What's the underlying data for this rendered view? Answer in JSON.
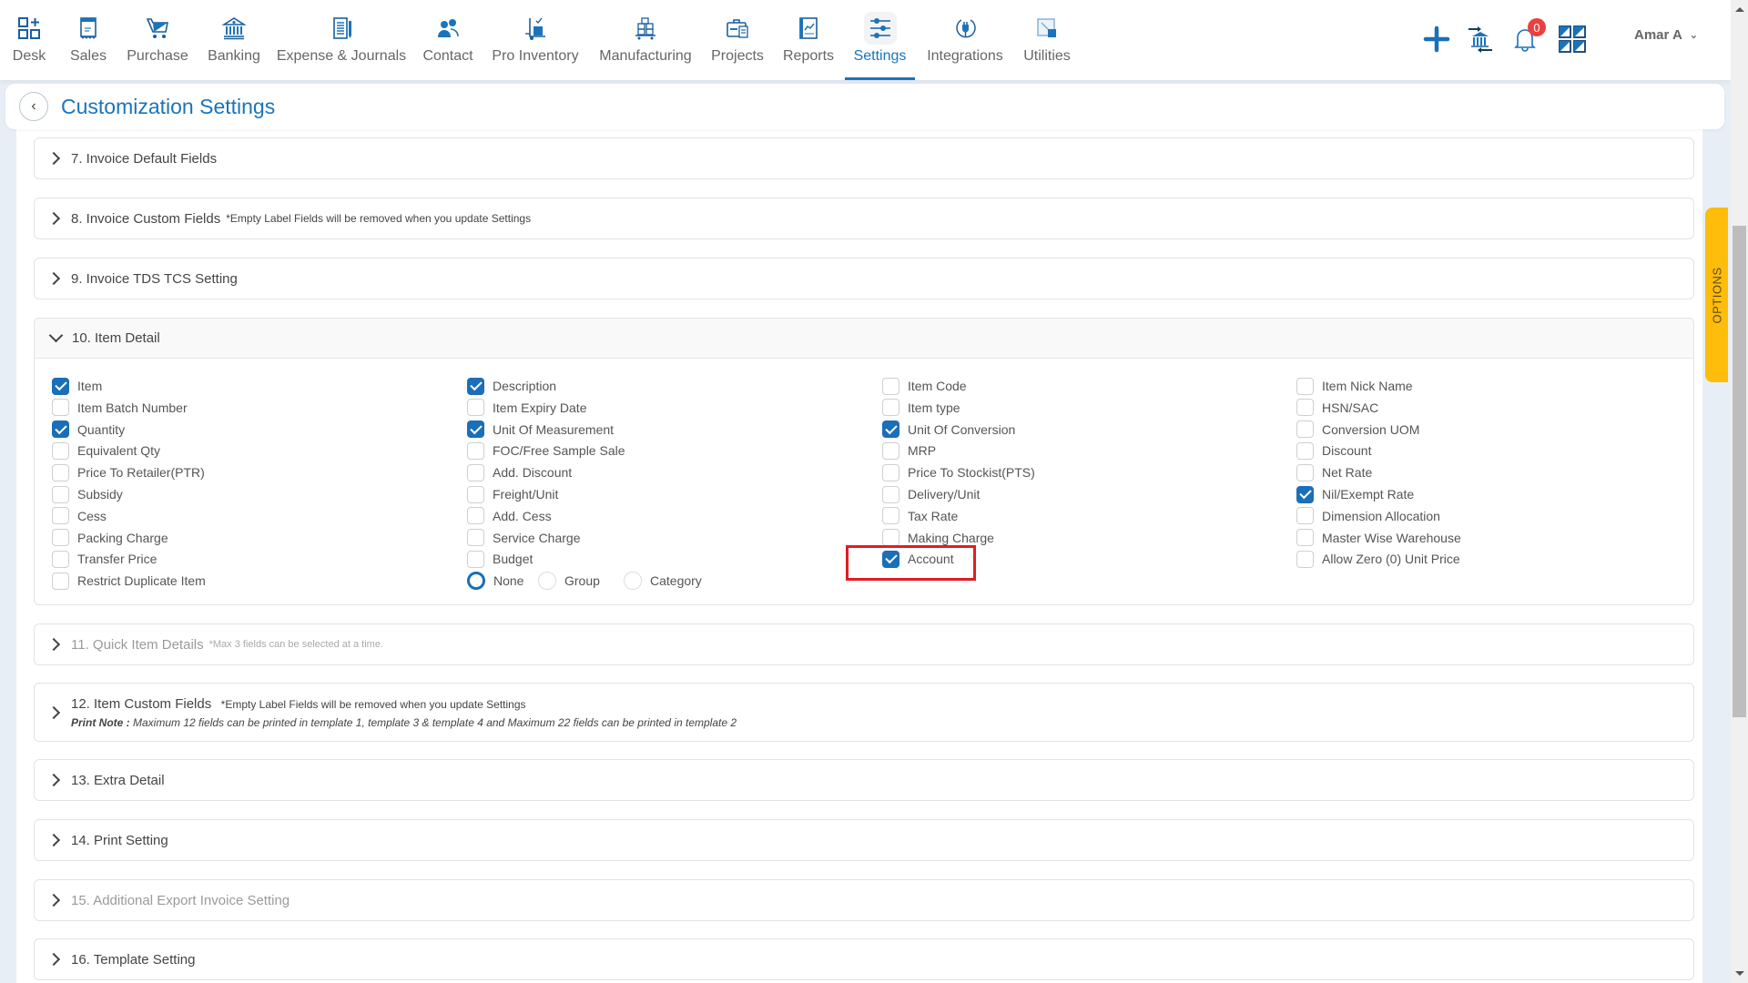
{
  "nav": {
    "items": [
      {
        "label": "Desk",
        "icon": "desk-icon"
      },
      {
        "label": "Sales",
        "icon": "sales-receipt-icon"
      },
      {
        "label": "Purchase",
        "icon": "cart-icon"
      },
      {
        "label": "Banking",
        "icon": "bank-icon"
      },
      {
        "label": "Expense & Journals",
        "icon": "journal-icon"
      },
      {
        "label": "Contact",
        "icon": "contacts-icon"
      },
      {
        "label": "Pro Inventory",
        "icon": "inventory-trolley-icon"
      },
      {
        "label": "Manufacturing",
        "icon": "manufacturing-icon"
      },
      {
        "label": "Projects",
        "icon": "briefcase-icon"
      },
      {
        "label": "Reports",
        "icon": "report-chart-icon"
      },
      {
        "label": "Settings",
        "icon": "sliders-icon",
        "active": true
      },
      {
        "label": "Integrations",
        "icon": "plug-icon"
      },
      {
        "label": "Utilities",
        "icon": "utilities-icon"
      }
    ],
    "notifications_count": "0",
    "user_name": "Amar A",
    "accent_color": "#1a74bb"
  },
  "page": {
    "title": "Customization Settings",
    "options_tab": "OPTIONS"
  },
  "sections": {
    "s7": {
      "title": "7. Invoice Default Fields"
    },
    "s8": {
      "title": "8. Invoice Custom Fields",
      "note": "*Empty Label Fields will be removed when you update Settings"
    },
    "s9": {
      "title": "9. Invoice TDS TCS Setting"
    },
    "s10": {
      "title": "10. Item Detail"
    },
    "s11": {
      "title": "11. Quick Item Details",
      "note": "*Max 3 fields can be selected at a time."
    },
    "s12": {
      "title": "12. Item Custom Fields",
      "note": "*Empty Label Fields will be removed when you update Settings",
      "print_note_label": "Print Note :",
      "print_note": " Maximum 12 fields can be printed in template 1, template 3 & template 4 and Maximum 22 fields can be printed in template 2"
    },
    "s13": {
      "title": "13. Extra Detail"
    },
    "s14": {
      "title": "14. Print Setting"
    },
    "s15": {
      "title": "15. Additional Export Invoice Setting"
    },
    "s16": {
      "title": "16. Template Setting"
    }
  },
  "item_detail": {
    "columns": [
      [
        {
          "label": "Item",
          "checked": true
        },
        {
          "label": "Item Batch Number",
          "checked": false
        },
        {
          "label": "Quantity",
          "checked": true
        },
        {
          "label": "Equivalent Qty",
          "checked": false
        },
        {
          "label": "Price To Retailer(PTR)",
          "checked": false
        },
        {
          "label": "Subsidy",
          "checked": false
        },
        {
          "label": "Cess",
          "checked": false
        },
        {
          "label": "Packing Charge",
          "checked": false
        },
        {
          "label": "Transfer Price",
          "checked": false
        },
        {
          "label": "Restrict Duplicate Item",
          "checked": false
        }
      ],
      [
        {
          "label": "Description",
          "checked": true
        },
        {
          "label": "Item Expiry Date",
          "checked": false
        },
        {
          "label": "Unit Of Measurement",
          "checked": true
        },
        {
          "label": "FOC/Free Sample Sale",
          "checked": false
        },
        {
          "label": "Add. Discount",
          "checked": false
        },
        {
          "label": "Freight/Unit",
          "checked": false
        },
        {
          "label": "Add. Cess",
          "checked": false
        },
        {
          "label": "Service Charge",
          "checked": false
        },
        {
          "label": "Budget",
          "checked": false
        }
      ],
      [
        {
          "label": "Item Code",
          "checked": false
        },
        {
          "label": "Item type",
          "checked": false
        },
        {
          "label": "Unit Of Conversion",
          "checked": true
        },
        {
          "label": "MRP",
          "checked": false
        },
        {
          "label": "Price To Stockist(PTS)",
          "checked": false
        },
        {
          "label": "Delivery/Unit",
          "checked": false
        },
        {
          "label": "Tax Rate",
          "checked": false
        },
        {
          "label": "Making Charge",
          "checked": false
        },
        {
          "label": "Account",
          "checked": true
        }
      ],
      [
        {
          "label": "Item Nick Name",
          "checked": false
        },
        {
          "label": "HSN/SAC",
          "checked": false
        },
        {
          "label": "Conversion UOM",
          "checked": false
        },
        {
          "label": "Discount",
          "checked": false
        },
        {
          "label": "Net Rate",
          "checked": false
        },
        {
          "label": "Nil/Exempt Rate",
          "checked": true
        },
        {
          "label": "Dimension Allocation",
          "checked": false
        },
        {
          "label": "Master Wise Warehouse",
          "checked": false
        },
        {
          "label": "Allow Zero (0) Unit Price",
          "checked": false
        }
      ]
    ],
    "budget_options": [
      {
        "label": "None",
        "selected": true
      },
      {
        "label": "Group",
        "selected": false
      },
      {
        "label": "Category",
        "selected": false
      }
    ]
  }
}
